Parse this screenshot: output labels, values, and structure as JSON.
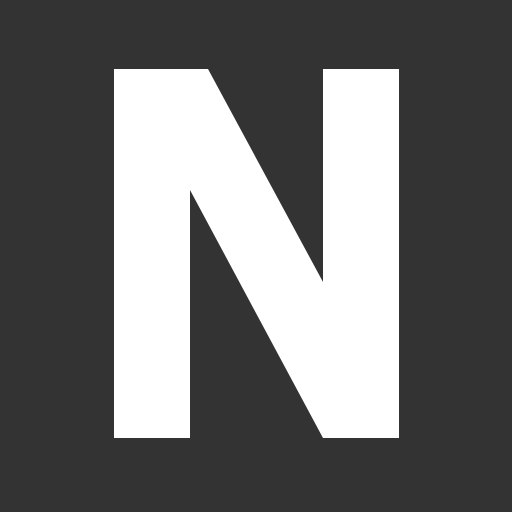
{
  "logo": {
    "letter": "N",
    "icon": "n-letter-logo-icon",
    "background_color": "#333333",
    "foreground_color": "#FFFFFF"
  }
}
